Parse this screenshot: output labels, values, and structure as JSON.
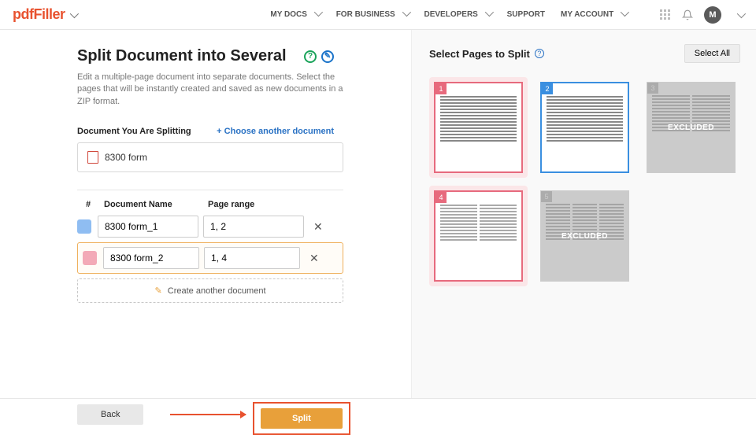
{
  "header": {
    "logo": "pdfFiller",
    "nav": [
      "MY DOCS",
      "FOR BUSINESS",
      "DEVELOPERS",
      "SUPPORT",
      "MY ACCOUNT"
    ],
    "avatar_initial": "M"
  },
  "left_panel": {
    "title": "Split Document into Several",
    "description": "Edit a multiple-page document into separate documents. Select the pages that will be instantly created and saved as new documents in a ZIP format.",
    "splitting_label": "Document You Are Splitting",
    "choose_another": "+ Choose another document",
    "document_name": "8300 form",
    "columns": {
      "num": "#",
      "name": "Document Name",
      "range": "Page range"
    },
    "rows": [
      {
        "color": "blue",
        "name": "8300 form_1",
        "range": "1, 2",
        "active": false
      },
      {
        "color": "pink",
        "name": "8300 form_2",
        "range": "1, 4",
        "active": true
      }
    ],
    "create_another": "Create another document"
  },
  "right_panel": {
    "title": "Select Pages to Split",
    "select_all": "Select All",
    "excluded_label": "EXCLUDED",
    "pages": [
      {
        "num": "1",
        "sel": "pink",
        "layout": "lines"
      },
      {
        "num": "2",
        "sel": "blue",
        "layout": "lines"
      },
      {
        "num": "3",
        "sel": "excluded",
        "layout": "cols"
      },
      {
        "num": "4",
        "sel": "pink",
        "layout": "cols"
      },
      {
        "num": "5",
        "sel": "excluded",
        "layout": "cols"
      }
    ]
  },
  "footer": {
    "back": "Back",
    "split": "Split"
  }
}
